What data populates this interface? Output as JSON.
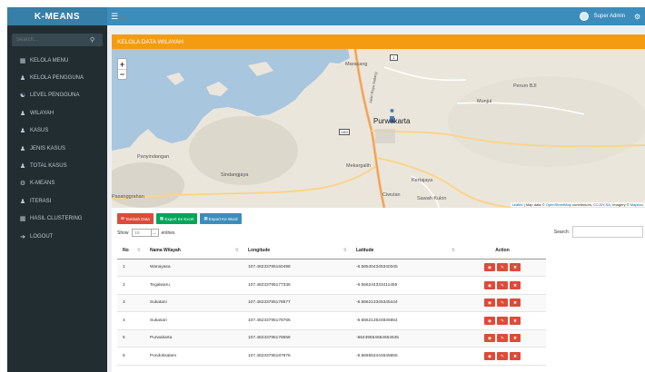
{
  "brand": "K-MEANS",
  "search": {
    "placeholder": "Search..."
  },
  "menu": [
    {
      "label": "KELOLA MENU",
      "icon": "table-icon"
    },
    {
      "label": "KELOLA PENGGUNA",
      "icon": "user-icon"
    },
    {
      "label": "LEVEL PENGGUNA",
      "icon": "users-icon"
    },
    {
      "label": "WILAYAH",
      "icon": "user-icon"
    },
    {
      "label": "KASUS",
      "icon": "user-icon"
    },
    {
      "label": "JENIS KASUS",
      "icon": "user-icon"
    },
    {
      "label": "TOTAL KASUS",
      "icon": "user-icon"
    },
    {
      "label": "K-MEANS",
      "icon": "gear-icon"
    },
    {
      "label": "ITERASI",
      "icon": "user-icon"
    },
    {
      "label": "HASIL CLUSTERING",
      "icon": "table-icon"
    },
    {
      "label": "LOGOUT",
      "icon": "sign-out-icon"
    }
  ],
  "topbar": {
    "user": "Super Admin"
  },
  "panel": {
    "title": "KELOLA DATA WILAYAH"
  },
  "map": {
    "places": {
      "maracang": "Maracang",
      "perum": "Perum BJI",
      "munjul": "Munjul",
      "purwakarta": "Purwakarta",
      "panyindangan": "Panyindangan",
      "sindangsari": "Sindangjaya",
      "mekargalih": "Mekargalih",
      "kertajaya": "Kertajaya",
      "ciwulan": "Ciwulan",
      "sawah": "Sawah Kulon",
      "pasanggrahan": "Pasanggrahan",
      "road_nw": "Jalan Raya Sadang",
      "shield1": "1",
      "shield2": "ABB"
    },
    "attribution": {
      "leaflet": "Leaflet",
      "middle": " | Map data © ",
      "osm": "OpenStreetMap",
      "contributors": " contributors, ",
      "license": "CC-BY-SA",
      "imagery": ", Imagery © ",
      "mapbox": "Mapbox"
    }
  },
  "buttons": {
    "add": "Tambah Data",
    "excel": "Export Ke Excel",
    "word": "Export Ke Word"
  },
  "table_controls": {
    "show": "Show",
    "entries_value": "10",
    "entries": "entries",
    "search": "Search:"
  },
  "table": {
    "headers": [
      "No",
      "Nama Wilayah",
      "Longitude",
      "Latitude",
      "Action"
    ],
    "rows": [
      [
        "1",
        "Wanayasa",
        "107.48233795150498",
        "-6.565404345340345"
      ],
      [
        "2",
        "Tegalwaru",
        "107.48233795177335",
        "-6.566244333411455"
      ],
      [
        "3",
        "Sukatani",
        "107.48233795178677",
        "-6.566213345345444"
      ],
      [
        "4",
        "Sukasari",
        "107.48233795178765",
        "-6.566213634845654"
      ],
      [
        "5",
        "Purwakarta",
        "107.48233795178656",
        "-66449654654654645"
      ],
      [
        "6",
        "Pondoksalam",
        "107.48233795187976",
        "-6.566653444645655"
      ]
    ]
  },
  "colors": {
    "header": "#3c8dbc",
    "brand": "#367fa9",
    "sidebar": "#222d32",
    "panel": "#f39c12",
    "danger": "#dd4b39",
    "success": "#00a65a"
  }
}
